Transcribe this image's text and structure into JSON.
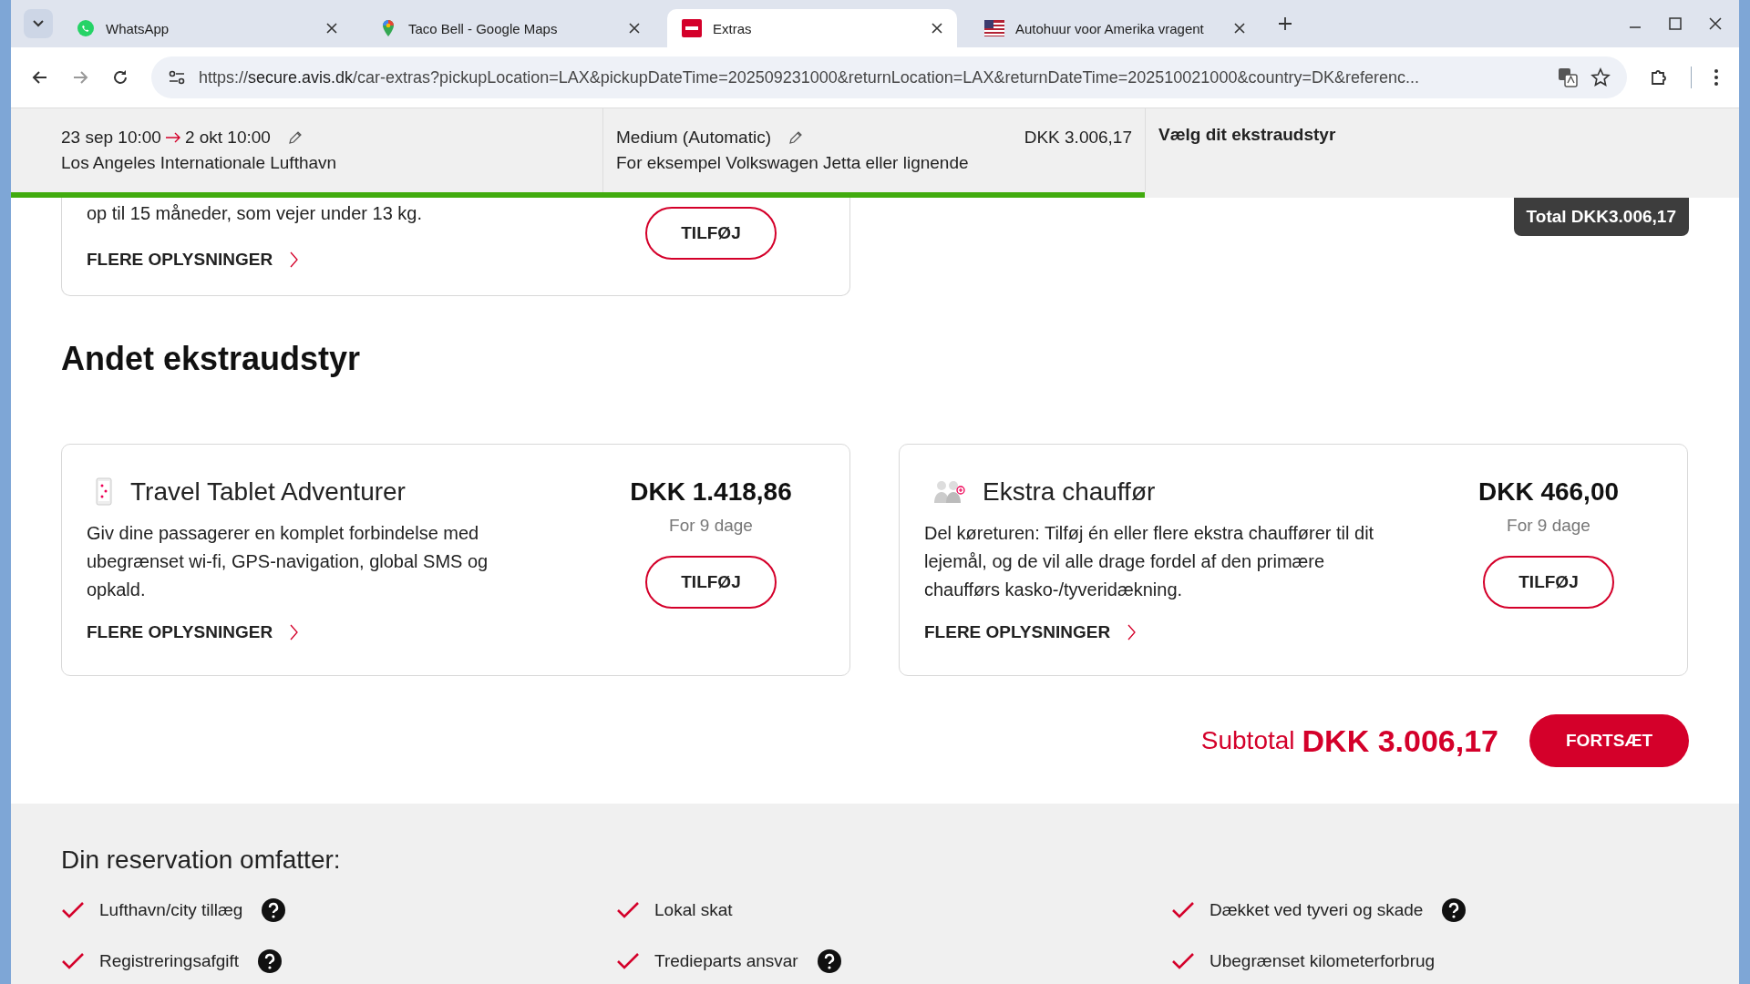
{
  "browser": {
    "tabs": [
      {
        "title": "WhatsApp",
        "selected": false,
        "kind": "whatsapp"
      },
      {
        "title": "Taco Bell - Google Maps",
        "selected": false,
        "kind": "maps"
      },
      {
        "title": "Extras",
        "selected": true,
        "kind": "avis"
      },
      {
        "title": "Autohuur voor Amerika vragent",
        "selected": false,
        "kind": "flag"
      }
    ],
    "url_scheme": "https://",
    "url_host": "secure.avis.dk",
    "url_rest": "/car-extras?pickupLocation=LAX&pickupDateTime=202509231000&returnLocation=LAX&returnDateTime=202510021000&country=DK&referenc..."
  },
  "summary": {
    "pickup": "23 sep 10:00",
    "return": "2 okt 10:00",
    "location": "Los Angeles Internationale Lufthavn",
    "car": "Medium (Automatic)",
    "car_example": "For eksempel Volkswagen Jetta eller lignende",
    "price": "DKK 3.006,17",
    "step": "Vælg dit ekstraudstyr",
    "progress": {
      "level": 0.656
    }
  },
  "total_badge": "Total DKK3.006,17",
  "partial_card": {
    "description": "op til 15 måneder, som vejer under 13 kg.",
    "link": "FLERE OPLYSNINGER",
    "button": "TILFØJ"
  },
  "section_title": "Andet ekstraudstyr",
  "extras": [
    {
      "kind": "tablet",
      "title": "Travel Tablet Adventurer",
      "price": "DKK 1.418,86",
      "period": "For 9 dage",
      "description": "Giv dine passagerer en komplet forbindelse med ubegrænset wi-fi, GPS-navigation, global SMS og opkald.",
      "link": "FLERE OPLYSNINGER",
      "button": "TILFØJ"
    },
    {
      "kind": "driver",
      "title": "Ekstra chauffør",
      "price": "DKK 466,00",
      "period": "For 9 dage",
      "description": "Del køreturen: Tilføj én eller flere ekstra chauffører til dit lejemål, og de vil alle drage fordel af den primære chaufførs kasko-/tyveridækning.",
      "link": "FLERE OPLYSNINGER",
      "button": "TILFØJ"
    }
  ],
  "subtotal": {
    "label": "Subtotal",
    "amount": "DKK 3.006,17",
    "button": "FORTSÆT"
  },
  "includes": {
    "title": "Din reservation omfatter:",
    "items": [
      {
        "label": "Lufthavn/city tillæg",
        "help": true
      },
      {
        "label": "Lokal skat",
        "help": false
      },
      {
        "label": "Dækket ved tyveri og skade",
        "help": true
      },
      {
        "label": "Registreringsafgift",
        "help": true
      },
      {
        "label": "Tredieparts ansvar",
        "help": true
      },
      {
        "label": "Ubegrænset kilometerforbrug",
        "help": false
      }
    ]
  }
}
